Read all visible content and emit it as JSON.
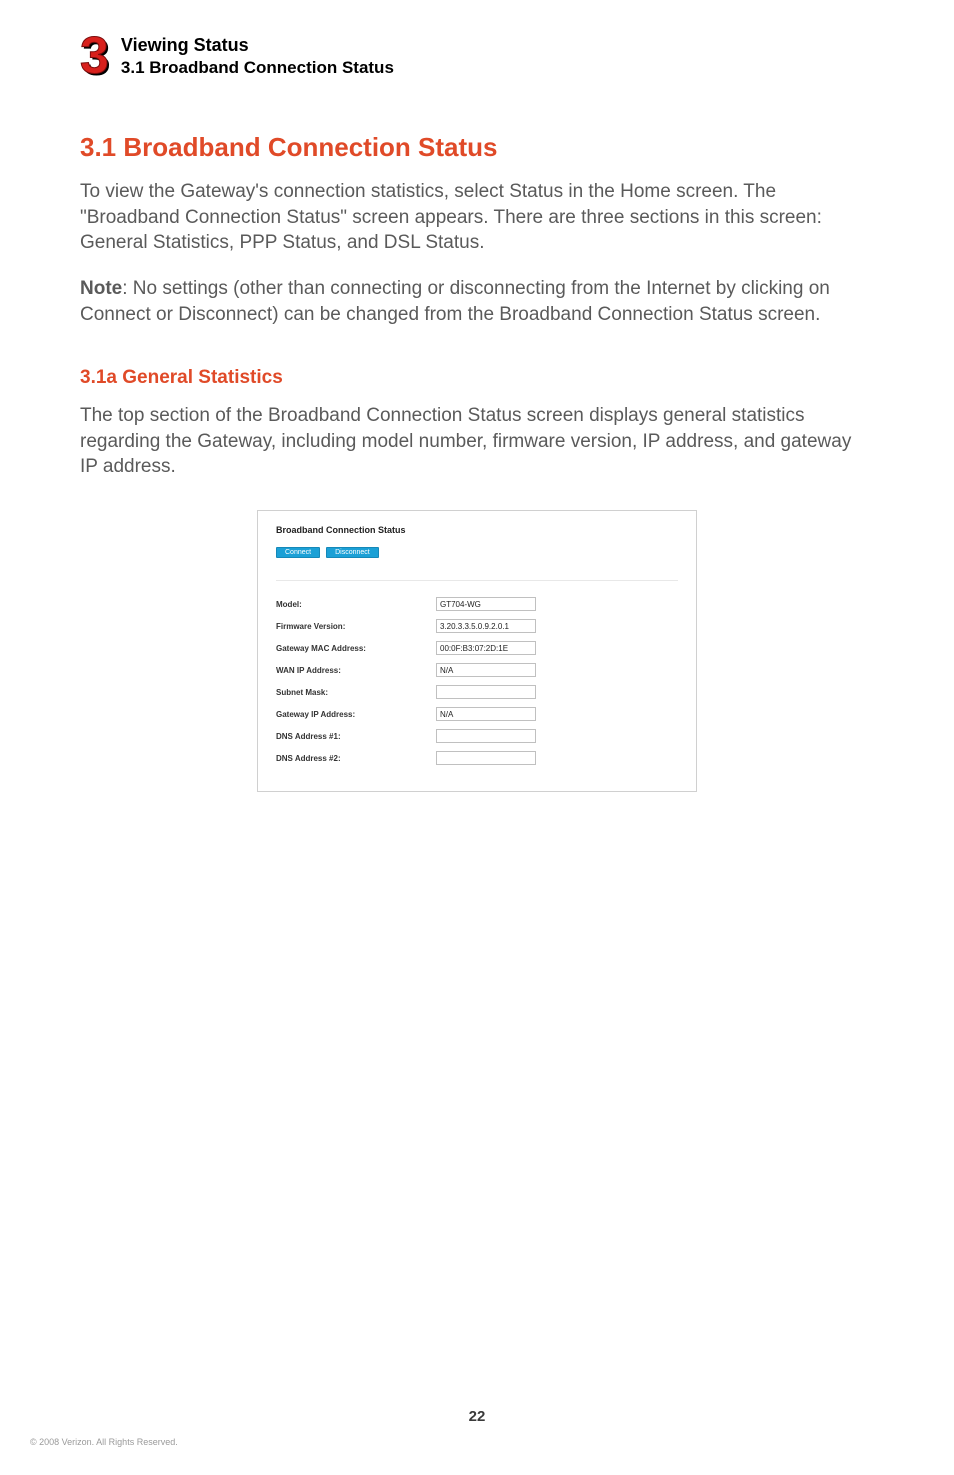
{
  "header": {
    "chapter_number": "3",
    "line1": "Viewing Status",
    "line2": "3.1  Broadband Connection Status"
  },
  "section_title": "3.1  Broadband Connection Status",
  "para1": "To view the Gateway's connection statistics, select Status in the Home screen. The \"Broadband Connection Status\" screen appears.  There are three sections in this screen: General Statistics, PPP Status, and DSL Status.",
  "note_label": "Note",
  "note_text": ": No settings (other than connecting or disconnecting from the Internet by clicking on Connect or Disconnect) can be changed from the Broadband Connection Status screen.",
  "subsection_title": "3.1a  General Statistics",
  "para2": "The top section of the Broadband Connection Status screen displays general statistics regarding the Gateway, including model number, firmware version, IP address, and gateway IP address.",
  "panel": {
    "title": "Broadband Connection Status",
    "connect_btn": "Connect",
    "disconnect_btn": "Disconnect",
    "rows": {
      "model_label": "Model:",
      "model_value": "GT704-WG",
      "fw_label": "Firmware Version:",
      "fw_value": "3.20.3.3.5.0.9.2.0.1",
      "mac_label": "Gateway MAC Address:",
      "mac_value": "00:0F:B3:07:2D:1E",
      "wanip_label": "WAN IP Address:",
      "wanip_value": "N/A",
      "subnet_label": "Subnet Mask:",
      "subnet_value": "",
      "gwip_label": "Gateway IP Address:",
      "gwip_value": "N/A",
      "dns1_label": "DNS Address #1:",
      "dns1_value": "",
      "dns2_label": "DNS Address #2:",
      "dns2_value": ""
    }
  },
  "page_number": "22",
  "copyright": "© 2008 Verizon. All Rights Reserved."
}
